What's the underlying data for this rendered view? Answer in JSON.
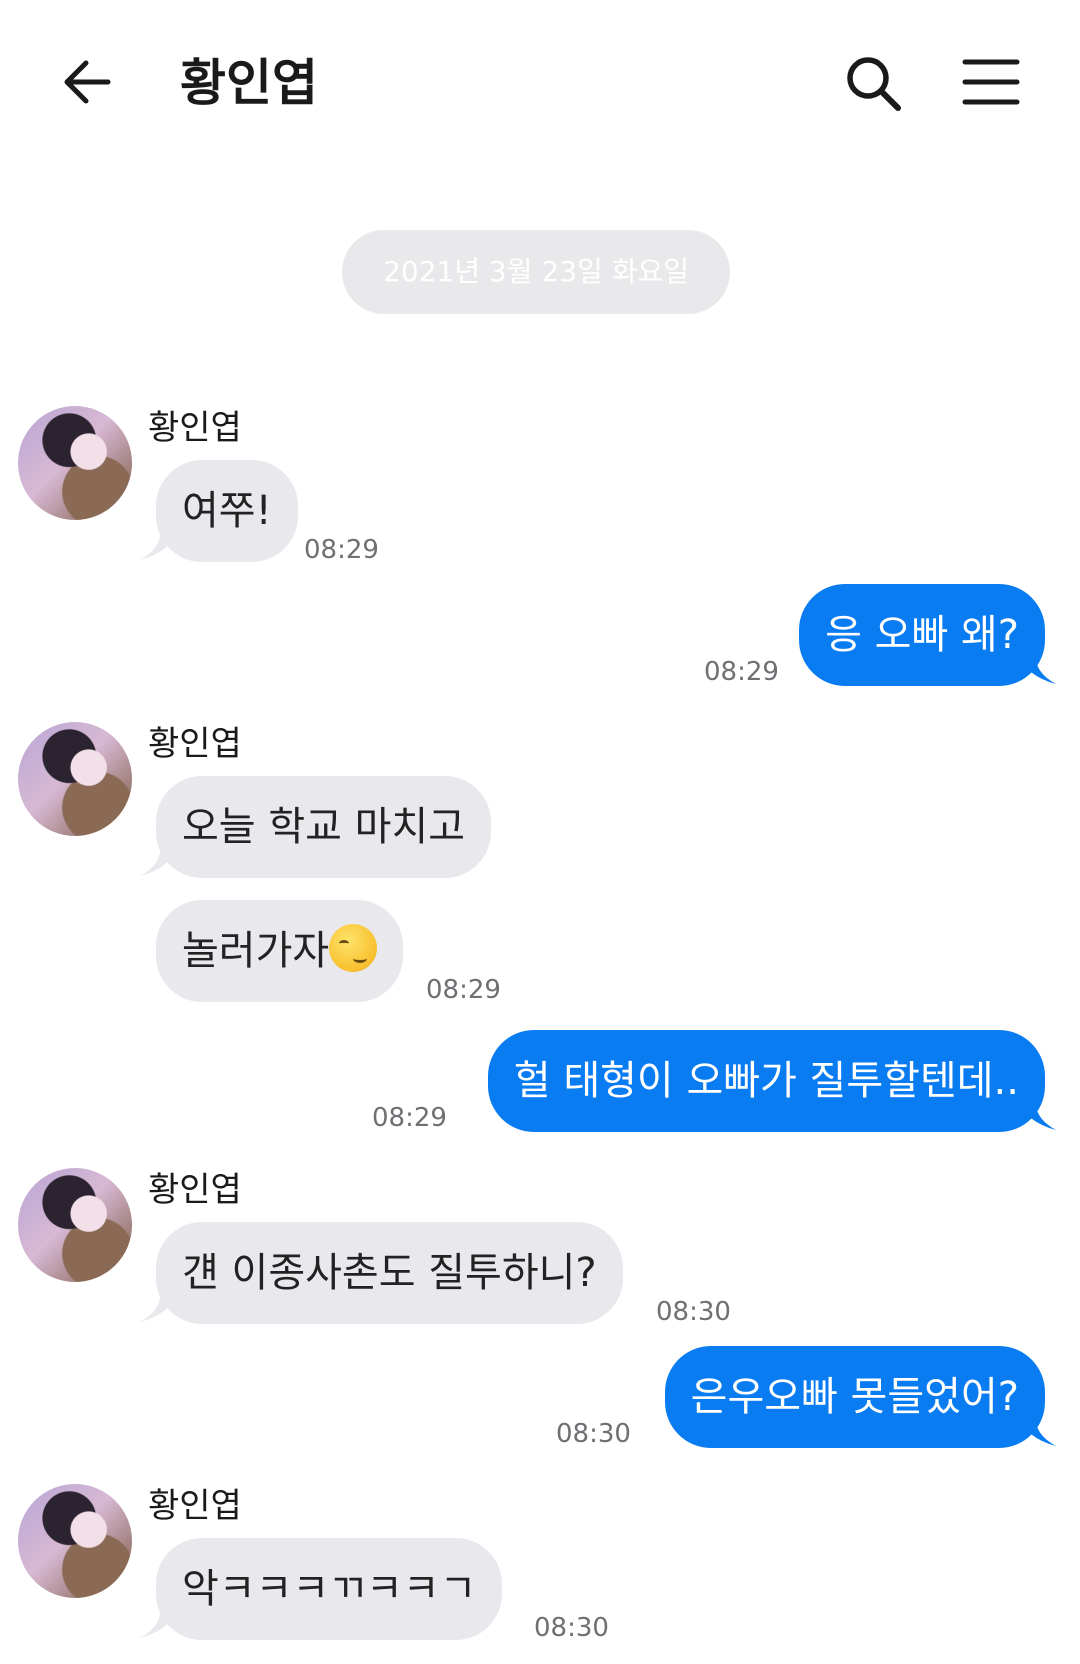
{
  "header": {
    "title": "황인엽",
    "back_icon": "arrow-left-icon",
    "search_icon": "search-icon",
    "menu_icon": "hamburger-menu-icon"
  },
  "date_divider": "2021년 3월 23일 화요일",
  "colors": {
    "outgoing_bubble": "#0a7cf2",
    "incoming_bubble": "#e8e8ed",
    "date_pill": "#e9e9ec"
  },
  "messages": [
    {
      "dir": "in",
      "sender": "황인엽",
      "text": "여쭈!",
      "time": "08:29"
    },
    {
      "dir": "out",
      "text": "응 오빠 왜?",
      "time": "08:29"
    },
    {
      "dir": "in",
      "sender": "황인엽",
      "text": "오늘 학교 마치고"
    },
    {
      "dir": "in",
      "text": "놀러가자",
      "emoji": "smirking-face",
      "time": "08:29"
    },
    {
      "dir": "out",
      "text": "헐 태형이 오빠가 질투할텐데..",
      "time": "08:29"
    },
    {
      "dir": "in",
      "sender": "황인엽",
      "text": "걘 이종사촌도 질투하니?",
      "time": "08:30"
    },
    {
      "dir": "out",
      "text": "은우오빠 못들었어?",
      "time": "08:30"
    },
    {
      "dir": "in",
      "sender": "황인엽",
      "text": "악ㅋㅋㅋㄲㅋㅋㄱ",
      "time": "08:30"
    }
  ]
}
